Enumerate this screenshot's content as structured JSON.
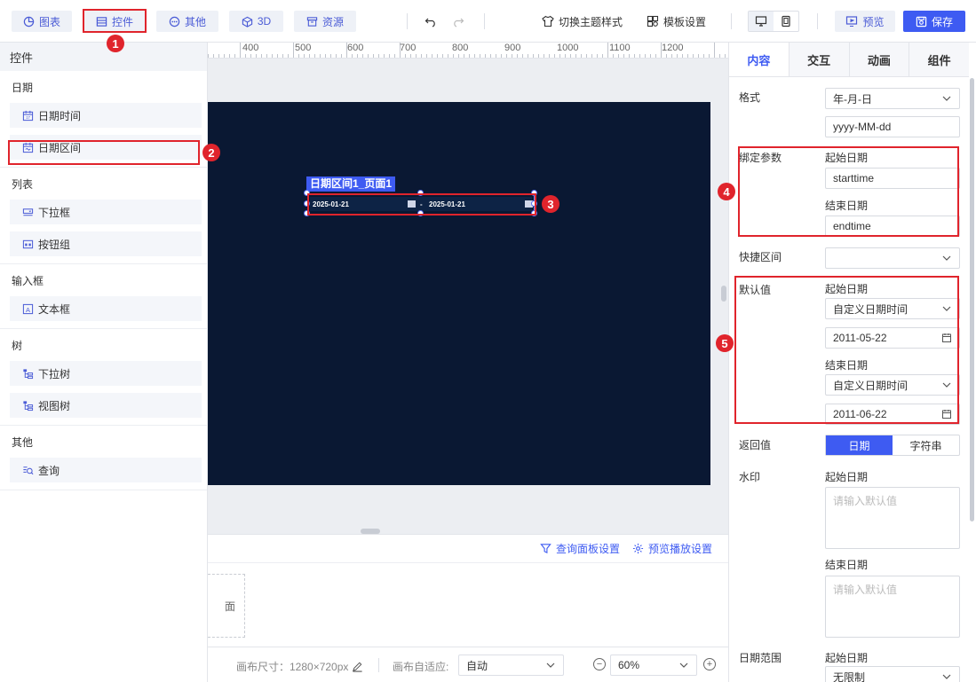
{
  "toolbar": {
    "chart_label": "图表",
    "control_label": "控件",
    "other_label": "其他",
    "three_d_label": "3D",
    "resource_label": "资源",
    "theme_label": "切换主题样式",
    "template_label": "模板设置",
    "preview_label": "预览",
    "save_label": "保存"
  },
  "left_panel": {
    "title": "控件",
    "sections": [
      {
        "title": "日期",
        "items": [
          "日期时间",
          "日期区间"
        ]
      },
      {
        "title": "列表",
        "items": [
          "下拉框",
          "按钮组"
        ]
      },
      {
        "title": "输入框",
        "items": [
          "文本框"
        ]
      },
      {
        "title": "树",
        "items": [
          "下拉树",
          "视图树"
        ]
      },
      {
        "title": "其他",
        "items": [
          "查询"
        ]
      }
    ]
  },
  "ruler": {
    "labels": [
      "400",
      "500",
      "600",
      "700",
      "800",
      "900",
      "1000",
      "1100",
      "1200"
    ]
  },
  "canvas": {
    "component_label": "日期区间1_页面1",
    "start_date": "2025-01-21",
    "separator": "-",
    "end_date": "2025-01-21"
  },
  "callouts": [
    "1",
    "2",
    "3",
    "4",
    "5"
  ],
  "bottom_panel": {
    "query_panel_settings": "查询面板设置",
    "preview_play_settings": "预览播放设置",
    "page_card_label": "面"
  },
  "status_bar": {
    "canvas_size": "画布尺寸：1280×720px",
    "canvas_fit_label": "画布自适应:",
    "canvas_fit_value": "自动",
    "zoom_value": "60%"
  },
  "right_panel": {
    "tabs": [
      "内容",
      "交互",
      "动画",
      "组件"
    ],
    "format_label": "格式",
    "format_value": "年-月-日",
    "format_pattern": "yyyy-MM-dd",
    "bind_label": "绑定参数",
    "bind_start_label": "起始日期",
    "bind_start_value": "starttime",
    "bind_end_label": "结束日期",
    "bind_end_value": "endtime",
    "shortcut_label": "快捷区间",
    "shortcut_value": "",
    "default_label": "默认值",
    "default_start_label": "起始日期",
    "default_start_type": "自定义日期时间",
    "default_start_date": "2011-05-22",
    "default_end_label": "结束日期",
    "default_end_type": "自定义日期时间",
    "default_end_date": "2011-06-22",
    "return_label": "返回值",
    "return_options": [
      "日期",
      "字符串"
    ],
    "watermark_label": "水印",
    "watermark_start_label": "起始日期",
    "watermark_start_placeholder": "请输入默认值",
    "watermark_end_label": "结束日期",
    "watermark_end_placeholder": "请输入默认值",
    "range_label": "日期范围",
    "range_start_label": "起始日期",
    "range_start_value": "无限制"
  },
  "colors": {
    "accent": "#3e5bf2",
    "callout": "#e0242c",
    "canvas_bg": "#0a1833"
  }
}
